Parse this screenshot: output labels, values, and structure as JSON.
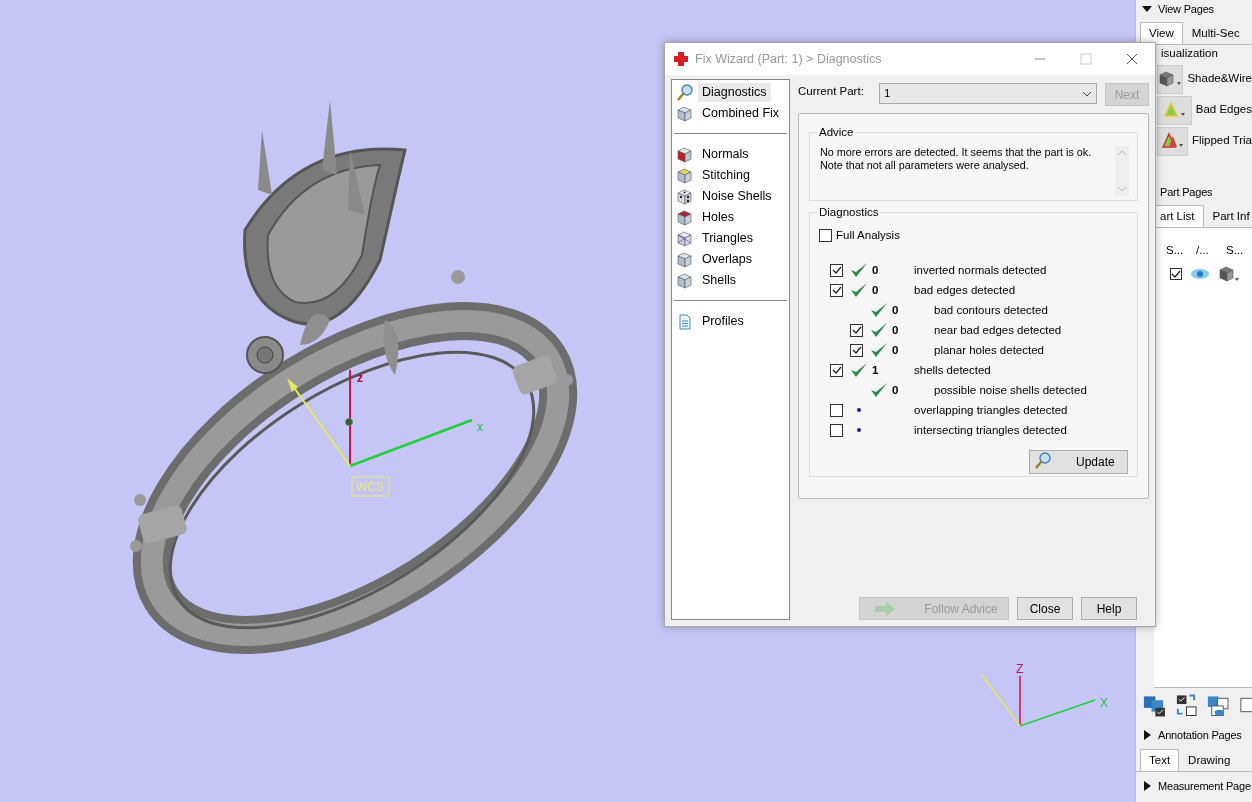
{
  "viewport": {
    "wcs_axes": {
      "z_label": "z",
      "x_label": "x",
      "tag": "WCS"
    },
    "corner_axes": {
      "z_label": "Z",
      "x_label": "X"
    }
  },
  "dialog": {
    "title": "Fix Wizard (Part: 1) > Diagnostics",
    "nav_groups": [
      [
        {
          "label": "Diagnostics",
          "kind": "magnifier",
          "selected": true
        },
        {
          "label": "Combined Fix",
          "kind": "cube",
          "selected": false
        }
      ],
      [
        {
          "label": "Normals",
          "kind": "cube-red-side",
          "selected": false
        },
        {
          "label": "Stitching",
          "kind": "cube-yellow",
          "selected": false
        },
        {
          "label": "Noise Shells",
          "kind": "dice",
          "selected": false
        },
        {
          "label": "Holes",
          "kind": "cube-red-top",
          "selected": false
        },
        {
          "label": "Triangles",
          "kind": "wire-cube",
          "selected": false
        },
        {
          "label": "Overlaps",
          "kind": "cube",
          "selected": false
        },
        {
          "label": "Shells",
          "kind": "cube",
          "selected": false
        }
      ],
      [
        {
          "label": "Profiles",
          "kind": "document",
          "selected": false
        }
      ]
    ],
    "current_part": {
      "label": "Current Part:",
      "value": "1"
    },
    "next_button": {
      "label": "Next",
      "disabled": true
    },
    "advice": {
      "title": "Advice",
      "text": "No more errors are detected. It seems that the part is ok.\nNote that not all parameters were analysed."
    },
    "diagnostics": {
      "title": "Diagnostics",
      "full_analysis": {
        "label": "Full Analysis",
        "checked": false
      },
      "rows": [
        {
          "kind": "checkbox",
          "checked": true,
          "analysed": true,
          "count": "0",
          "label": "inverted normals detected"
        },
        {
          "kind": "checkbox",
          "checked": true,
          "analysed": true,
          "count": "0",
          "label": "bad edges detected",
          "children": [
            {
              "kind": "plain",
              "analysed": true,
              "count": "0",
              "label": "bad contours detected"
            },
            {
              "kind": "checkbox",
              "checked": true,
              "analysed": true,
              "count": "0",
              "label": "near bad edges detected"
            },
            {
              "kind": "checkbox",
              "checked": true,
              "analysed": true,
              "count": "0",
              "label": "planar holes detected"
            }
          ]
        },
        {
          "kind": "checkbox",
          "checked": true,
          "analysed": true,
          "count": "1",
          "label": "shells detected",
          "children": [
            {
              "kind": "plain",
              "analysed": true,
              "count": "0",
              "label": "possible noise shells detected"
            }
          ]
        },
        {
          "kind": "checkbox",
          "checked": false,
          "analysed": false,
          "label": "overlapping triangles detected"
        },
        {
          "kind": "checkbox",
          "checked": false,
          "analysed": false,
          "label": "intersecting triangles detected"
        }
      ],
      "update_button": {
        "label": "Update"
      }
    },
    "buttons": [
      {
        "label": "Follow Advice",
        "kind": "arrow",
        "disabled": true
      },
      {
        "label": "Close",
        "kind": "plain",
        "disabled": false
      },
      {
        "label": "Help",
        "kind": "plain",
        "disabled": false
      }
    ]
  },
  "right_panel": {
    "view_pages": {
      "title": "View Pages",
      "expanded": true,
      "tabs": [
        {
          "label": "View",
          "selected": true
        },
        {
          "label": "Multi-Sec",
          "selected": false
        }
      ],
      "group": "isualization",
      "buttons": [
        {
          "label": "Shade&Wire",
          "kind": "cube"
        },
        {
          "label": "Bad Edges",
          "kind": "tri-edges"
        },
        {
          "label": "Flipped Tria",
          "kind": "tri-flipped"
        }
      ]
    },
    "part_pages": {
      "title": "Part Pages",
      "tabs": [
        {
          "label": "art List",
          "selected": true
        },
        {
          "label": "Part Inf",
          "selected": false
        }
      ],
      "columns": [
        "S...",
        "/...",
        "S..."
      ],
      "rows": [
        {
          "checked": true
        }
      ]
    },
    "annotation_pages": {
      "title": "Annotation Pages",
      "expanded": false,
      "tabs": [
        {
          "label": "Text",
          "selected": true
        },
        {
          "label": "Drawing",
          "selected": false
        }
      ]
    },
    "measurement_pages": {
      "title": "Measurement Page",
      "expanded": false
    }
  }
}
